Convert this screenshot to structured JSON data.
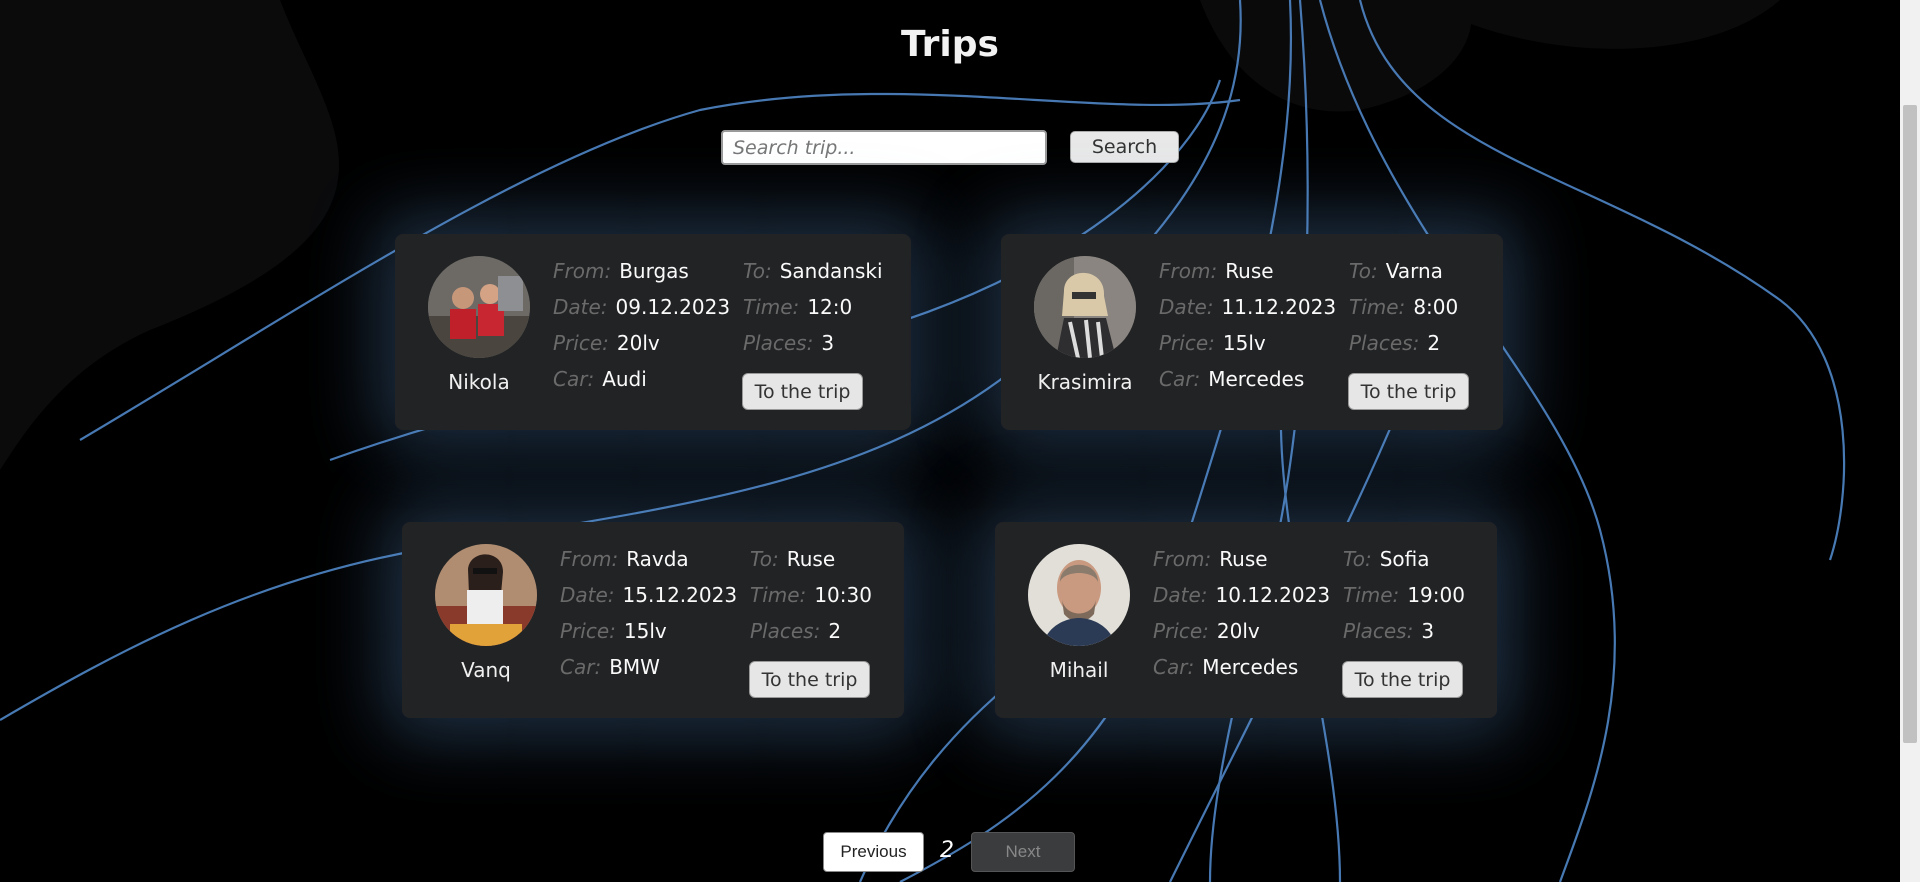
{
  "page": {
    "title": "Trips"
  },
  "search": {
    "placeholder": "Search trip...",
    "button_label": "Search"
  },
  "labels": {
    "from": "From:",
    "to": "To:",
    "date": "Date:",
    "time": "Time:",
    "price": "Price:",
    "places": "Places:",
    "car": "Car:"
  },
  "trips": [
    {
      "driver": "Nikola",
      "from": "Burgas",
      "to": "Sandanski",
      "date": "09.12.2023",
      "time": "12:0",
      "price": "20lv",
      "places": "3",
      "car": "Audi",
      "button_label": "To the trip"
    },
    {
      "driver": "Krasimira",
      "from": "Ruse",
      "to": "Varna",
      "date": "11.12.2023",
      "time": "8:00",
      "price": "15lv",
      "places": "2",
      "car": "Mercedes",
      "button_label": "To the trip"
    },
    {
      "driver": "Vanq",
      "from": "Ravda",
      "to": "Ruse",
      "date": "15.12.2023",
      "time": "10:30",
      "price": "15lv",
      "places": "2",
      "car": "BMW",
      "button_label": "To the trip"
    },
    {
      "driver": "Mihail",
      "from": "Ruse",
      "to": "Sofia",
      "date": "10.12.2023",
      "time": "19:00",
      "price": "20lv",
      "places": "3",
      "car": "Mercedes",
      "button_label": "To the trip"
    }
  ],
  "pagination": {
    "previous_label": "Previous",
    "current_page": "2",
    "next_label": "Next"
  },
  "colors": {
    "background": "#000000",
    "card": "#222325",
    "glow": "#5f96d2",
    "curves": "#4f86c6"
  }
}
